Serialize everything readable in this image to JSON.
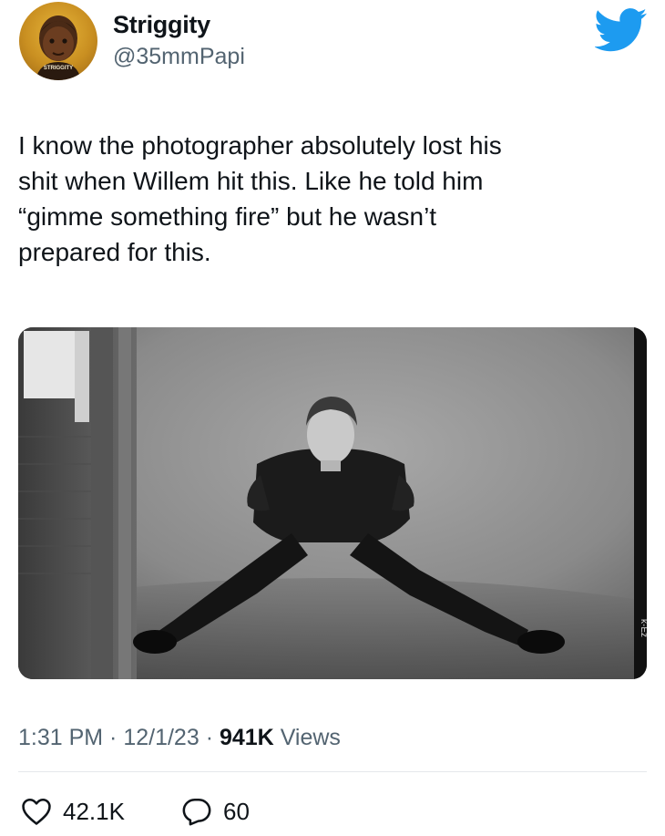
{
  "tweet": {
    "display_name": "Striggity",
    "handle": "@35mmPapi",
    "text_lines": [
      "I know the photographer absolutely lost his",
      "shit when Willem hit this. Like he told him",
      "“gimme something fire” but he wasn’t",
      "prepared for this."
    ],
    "time": "1:31 PM",
    "date": "12/1/23",
    "views_count": "941K",
    "views_label": "Views",
    "separator": " · ",
    "likes": "42.1K",
    "replies": "60"
  },
  "avatar_label": "STRIGGITY",
  "photo_mark": "k-Ez",
  "icons": {
    "brand": "twitter-bird-icon",
    "like": "heart-icon",
    "reply": "speech-bubble-icon"
  },
  "colors": {
    "brand_blue": "#1d9bf0",
    "text_primary": "#0f1419",
    "text_secondary": "#536471"
  }
}
